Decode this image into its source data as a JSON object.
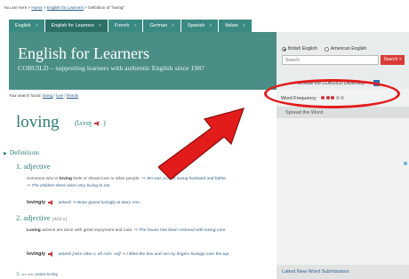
{
  "breadcrumb": {
    "prefix": "You are here",
    "items": [
      "Home",
      "English for Learners",
      "Definition of \"loving\""
    ]
  },
  "tabs": [
    {
      "label": "English",
      "active": false
    },
    {
      "label": "English for Learners",
      "active": true
    },
    {
      "label": "French",
      "active": false
    },
    {
      "label": "German",
      "active": false
    },
    {
      "label": "Spanish",
      "active": false
    },
    {
      "label": "Italian",
      "active": false
    }
  ],
  "banner": {
    "title": "English for Learners",
    "subtitle": "COBUILD – supporting learners with authentic English since 1987"
  },
  "sidebar": {
    "dialect_options": [
      "British English",
      "American English"
    ],
    "selected_dialect": "British English",
    "search_placeholder": "Search",
    "search_button": "Search",
    "browse_label": "Browse the COBUILD Dictionary"
  },
  "search_found": {
    "label": "Your search found:",
    "results": [
      "loving",
      "love",
      "friends"
    ]
  },
  "entry": {
    "headword": "loving",
    "pronunciation": "(lʌvɪŋ",
    "close_paren": ")",
    "definitions_heading": "Definitions",
    "senses": [
      {
        "number": "1.",
        "pos": "adjective",
        "code": "",
        "text_lead": "Someone who is",
        "text_bold": "loving",
        "text_tail": "feels or shows love to other people.",
        "example1": "Jim was a most loving husband and father.",
        "example2": "The children there were very loving to me.",
        "derivative": "lovingly",
        "derivative_pos": "adverb",
        "derivative_example": "Brian gazed lovingly at Mary Ann."
      },
      {
        "number": "2.",
        "pos": "adjective",
        "code": "[ADJ n]",
        "text_lead": "",
        "text_bold": "Loving",
        "text_tail": "actions are done with great enjoyment and care.",
        "example1": "The house has been restored with loving care.",
        "example2": "",
        "derivative": "lovingly",
        "derivative_pos": "adverb",
        "derivative_code": "[ADV after v, oft ADV -ed]",
        "derivative_example": "I lifted the box and ran my fingers lovingly over the top."
      }
    ],
    "third_line": {
      "number": "3.",
      "see_also": "see also",
      "target": "peace-loving"
    }
  },
  "right_column": {
    "word_frequency_label": "Word Frequency",
    "frequency_filled": 3,
    "frequency_total": 5,
    "spread_label": "Spread the Word",
    "latest_label": "Latest New Word Submissions"
  },
  "colors": {
    "teal": "#4b8e86",
    "tab_active": "#2c6f67",
    "heading_teal": "#2e7e76",
    "search_red": "#d93b36",
    "annotation_red": "#e21b1b"
  },
  "icons": [
    "speaker-icon",
    "browse-icon",
    "chevron-right-icon"
  ]
}
